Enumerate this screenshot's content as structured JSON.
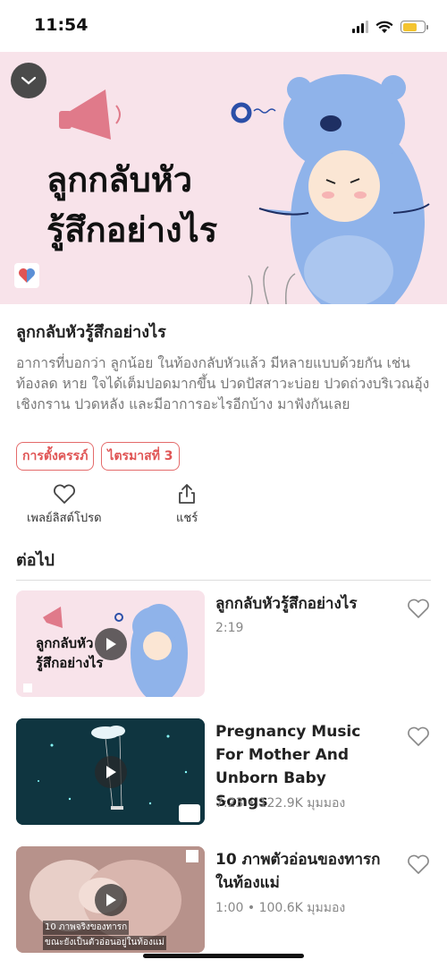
{
  "status": {
    "time": "11:54"
  },
  "hero": {
    "title_line1": "ลูกกลับหัว",
    "title_line2": "รู้สึกอย่างไร"
  },
  "info": {
    "title": "ลูกกลับหัวรู้สึกอย่างไร",
    "description": "อาการที่บอกว่า ลูกน้อย ในท้องกลับหัวแล้ว มีหลายแบบด้วยกัน เช่น ท้องลด หาย ใจได้เต็มปอดมากขึ้น ปวดปัสสาวะบ่อย ปวดถ่วงบริเวณอุ้งเชิงกราน ปวดหลัง และมีอาการอะไรอีกบ้าง มาฟังกันเลย",
    "tags": [
      "การตั้งครรภ์",
      "ไตรมาสที่ 3"
    ]
  },
  "actions": {
    "favorite_label": "เพลย์ลิสต์โปรด",
    "share_label": "แชร์"
  },
  "next_section": {
    "title": "ต่อไป"
  },
  "videos": [
    {
      "title": "ลูกกลับหัวรู้สึกอย่างไร",
      "meta": "2:19",
      "thumb_title": "ลูกกลับหัว\nรู้สึกอย่างไร"
    },
    {
      "title": "Pregnancy Music For Mother And Unborn Baby Songs",
      "meta": "7:23 • 122.9K มุมมอง"
    },
    {
      "title": "10 ภาพตัวอ่อนของทารก ในท้องแม่",
      "meta": "1:00 • 100.6K มุมมอง",
      "thumb_caption_line1": "10 ภาพจริงของทารก",
      "thumb_caption_line2": "ขณะยังเป็นตัวอ่อนอยู่ในท้องแม่"
    }
  ],
  "colors": {
    "accent": "#e05555",
    "hero_bg": "#f8e3ea",
    "bear": "#8fb3ea"
  }
}
